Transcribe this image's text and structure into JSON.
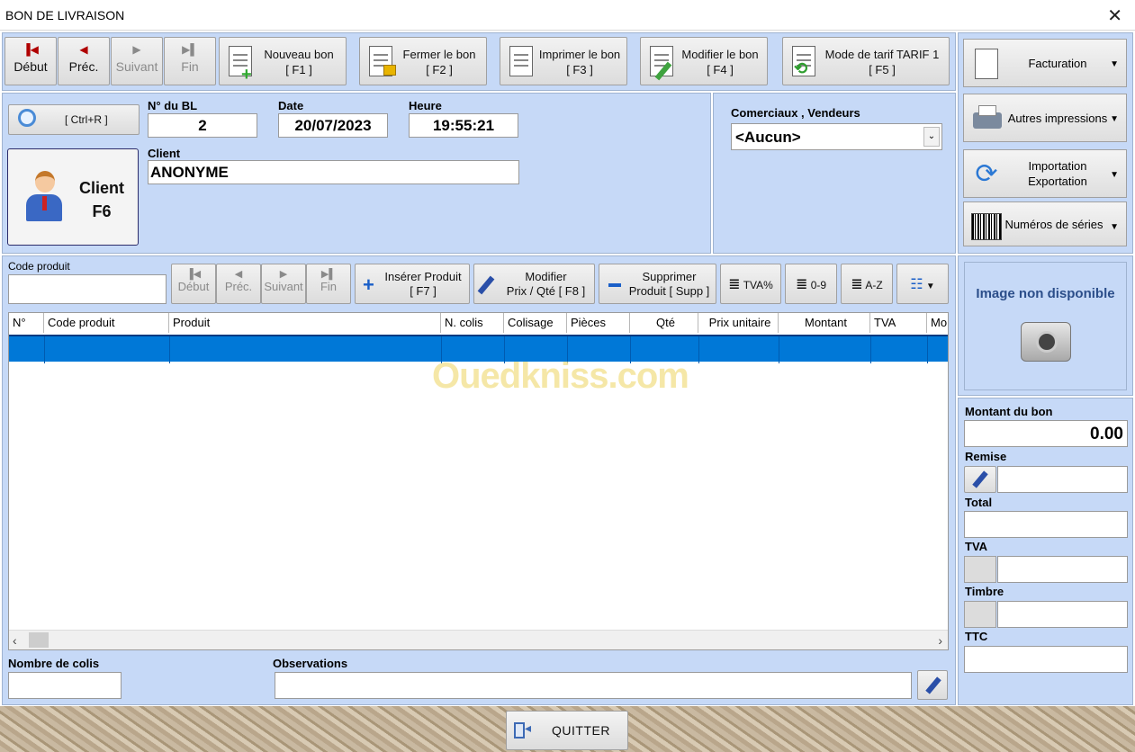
{
  "window": {
    "title": "BON DE LIVRAISON",
    "close_glyph": "✕"
  },
  "nav": [
    {
      "name": "debut",
      "label": "Début",
      "glyph": "▐◀",
      "disabled": false
    },
    {
      "name": "prec",
      "label": "Préc.",
      "glyph": "◀",
      "disabled": false
    },
    {
      "name": "suivant",
      "label": "Suivant",
      "glyph": "▶",
      "disabled": true
    },
    {
      "name": "fin",
      "label": "Fin",
      "glyph": "▶▌",
      "disabled": true
    }
  ],
  "toolbar": {
    "nouveau": {
      "line1": "Nouveau bon",
      "line2": "[ F1 ]"
    },
    "fermer": {
      "line1": "Fermer le bon",
      "line2": "[ F2 ]"
    },
    "imprimer": {
      "line1": "Imprimer le bon",
      "line2": "[ F3 ]"
    },
    "modifier": {
      "line1": "Modifier le bon",
      "line2": "[ F4 ]"
    },
    "tarif": {
      "line1": "Mode de tarif TARIF 1",
      "line2": "[ F5 ]"
    }
  },
  "side_buttons": {
    "facturation": "Facturation",
    "autres": "Autres impressions",
    "import": "Importation Exportation",
    "series": "Numéros de séries"
  },
  "header": {
    "search_shortcut": "[ Ctrl+R ]",
    "bl_label": "N° du BL",
    "bl_value": "2",
    "date_label": "Date",
    "date_value": "20/07/2023",
    "time_label": "Heure",
    "time_value": "19:55:21",
    "client_label": "Client",
    "client_value": "ANONYME",
    "client_button_line1": "Client",
    "client_button_line2": "F6",
    "vendeurs_label": "Comerciaux , Vendeurs",
    "vendeurs_value": "<Aucun>"
  },
  "product_bar": {
    "code_label": "Code produit",
    "code_value": "",
    "nav": [
      "Début",
      "Préc.",
      "Suivant",
      "Fin"
    ],
    "inserer": {
      "line1": "Insérer Produit",
      "line2": "[ F7 ]"
    },
    "modifier": {
      "line1": "Modifier",
      "line2": "Prix / Qté  [ F8 ]"
    },
    "supprimer": {
      "line1": "Supprimer",
      "line2": "Produit [ Supp ]"
    },
    "sort_tva": "TVA%",
    "sort_09": "0-9",
    "sort_az": "A-Z"
  },
  "table": {
    "columns": [
      "N°",
      "Code produit",
      "Produit",
      "N. colis",
      "Colisage",
      "Pièces",
      "Qté",
      "Prix unitaire",
      "Montant",
      "TVA",
      "Mo"
    ],
    "rows": []
  },
  "watermark": "Ouedkniss.com",
  "image_panel": {
    "text": "Image non disponible"
  },
  "summary": {
    "montant_label": "Montant du bon",
    "montant_value": "0.00",
    "remise_label": "Remise",
    "total_label": "Total",
    "tva_label": "TVA",
    "timbre_label": "Timbre",
    "ttc_label": "TTC"
  },
  "footer": {
    "colis_label": "Nombre de colis",
    "obs_label": "Observations",
    "quit_label": "QUITTER"
  },
  "colors": {
    "panel": "#c6d9f7",
    "selection": "#0078d7"
  }
}
